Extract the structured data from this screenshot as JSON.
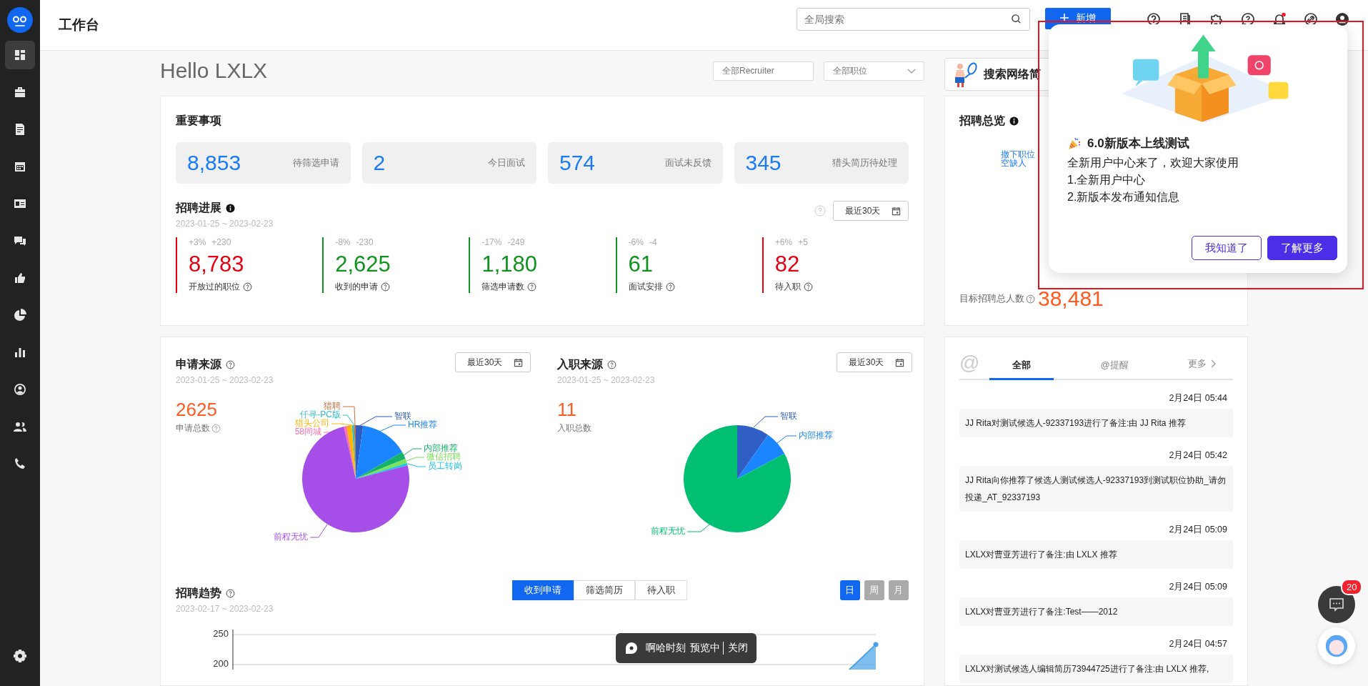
{
  "sidebar": {
    "items": [
      {
        "selected": true
      },
      {
        "selected": false
      },
      {
        "selected": false
      },
      {
        "selected": false
      },
      {
        "selected": false
      },
      {
        "selected": false
      },
      {
        "selected": false
      },
      {
        "selected": false
      },
      {
        "selected": false
      },
      {
        "selected": false
      },
      {
        "selected": false
      },
      {
        "selected": false
      }
    ]
  },
  "header": {
    "title": "工作台",
    "search": {
      "placeholder": "全局搜索"
    },
    "add_button": "新增",
    "notification_dot": true
  },
  "greeting": "Hello LXLX",
  "filters": {
    "recruiter": {
      "placeholder": "全部Recruiter"
    },
    "position": {
      "placeholder": "全部职位"
    }
  },
  "resume_search_button": "搜索网络简",
  "important": {
    "title": "重要事项",
    "tiles": [
      {
        "count": "8,853",
        "name": "待筛选申请"
      },
      {
        "count": "2",
        "name": "今日面试"
      },
      {
        "count": "574",
        "name": "面试未反馈"
      },
      {
        "count": "345",
        "name": "猎头简历待处理"
      }
    ]
  },
  "progress": {
    "title": "招聘进展",
    "date_range": "2023-01-25 ~ 2023-02-23",
    "period": "最近30天",
    "metrics": [
      {
        "change_pct": "+3%",
        "change": "+230",
        "value": "8,783",
        "label": "开放过的职位",
        "color": "#e60012"
      },
      {
        "change_pct": "-8%",
        "change": "-230",
        "value": "2,625",
        "label": "收到的申请",
        "color": "#10921e"
      },
      {
        "change_pct": "-17%",
        "change": "-249",
        "value": "1,180",
        "label": "筛选申请数",
        "color": "#10921e"
      },
      {
        "change_pct": "-6%",
        "change": "-4",
        "value": "61",
        "label": "面试安排",
        "color": "#10921e"
      },
      {
        "change_pct": "+6%",
        "change": "+5",
        "value": "82",
        "label": "待入职",
        "color": "#e60012"
      }
    ]
  },
  "overview": {
    "title": "招聘总览",
    "links": [
      "撤下职位",
      "空缺人"
    ],
    "target_label": "目标招聘总人数",
    "target_value": "38,481"
  },
  "application_source": {
    "title": "申请来源",
    "date_range": "2023-01-25 ~ 2023-02-23",
    "period": "最近30天",
    "total": "2625",
    "total_label": "申请总数",
    "slices": [
      {
        "label": "猎聘",
        "color": "#c8703c"
      },
      {
        "label": "仟寻-PC版",
        "color": "#2fbfc9"
      },
      {
        "label": "猎头公司",
        "color": "#ffb800"
      },
      {
        "label": "58同城",
        "color": "#ff6fa8"
      },
      {
        "label": "智联",
        "color": "#2f5bbf"
      },
      {
        "label": "HR推荐",
        "color": "#1a85ff"
      },
      {
        "label": "内部推荐",
        "color": "#14b36a"
      },
      {
        "label": "微信招聘",
        "color": "#7be05a"
      },
      {
        "label": "员工转岗",
        "color": "#1cc3e6"
      },
      {
        "label": "前程无忧",
        "color": "#a64fe8"
      }
    ]
  },
  "hire_source": {
    "title": "入职来源",
    "date_range": "2023-01-25 ~ 2023-02-23",
    "period": "最近30天",
    "total": "11",
    "total_label": "入职总数",
    "slices": [
      {
        "label": "智联",
        "color": "#2f5fc4"
      },
      {
        "label": "内部推荐",
        "color": "#1a85ff"
      },
      {
        "label": "前程无忧",
        "color": "#00bf73"
      }
    ]
  },
  "trend": {
    "title": "招聘趋势",
    "date_range": "2023-02-17 ~ 2023-02-23",
    "tabs": [
      {
        "label": "收到申请",
        "selected": true
      },
      {
        "label": "筛选简历",
        "selected": false
      },
      {
        "label": "待入职",
        "selected": false
      }
    ],
    "granularity": [
      {
        "label": "日",
        "selected": true
      },
      {
        "label": "周",
        "selected": false
      },
      {
        "label": "月",
        "selected": false
      }
    ],
    "axis_labels": [
      "250",
      "200"
    ]
  },
  "feed": {
    "icon": "@",
    "tabs": [
      {
        "label": "全部",
        "selected": true
      },
      {
        "label": "@提醒",
        "selected": false
      }
    ],
    "more_link": "更多",
    "items": [
      {
        "time": "2月24日 05:44",
        "text": "JJ Rita对测试候选人-92337193进行了备注:由 JJ Rita 推荐"
      },
      {
        "time": "2月24日 05:42",
        "text": "JJ Rita向你推荐了候选人测试候选人-92337193到测试职位协助_请勿投递_AT_92337193"
      },
      {
        "time": "2月24日 05:09",
        "text": "LXLX对曹亚芳进行了备注:由 LXLX 推荐"
      },
      {
        "time": "2月24日 05:09",
        "text": "LXLX对曹亚芳进行了备注:Test——2012"
      },
      {
        "time": "2月24日 04:57",
        "text": "LXLX对测试候选人编辑简历73944725进行了备注:由 LXLX 推荐,"
      }
    ]
  },
  "toast": {
    "text": "啊哈时刻",
    "status": "预览中",
    "close": "关闭"
  },
  "chat": {
    "badge": "20"
  },
  "popup": {
    "title": "6.0新版本上线测试",
    "lines": [
      "全新用户中心来了，欢迎大家使用",
      "1.全新用户中心",
      "2.新版本发布通知信息"
    ],
    "dismiss": "我知道了",
    "more": "了解更多"
  }
}
